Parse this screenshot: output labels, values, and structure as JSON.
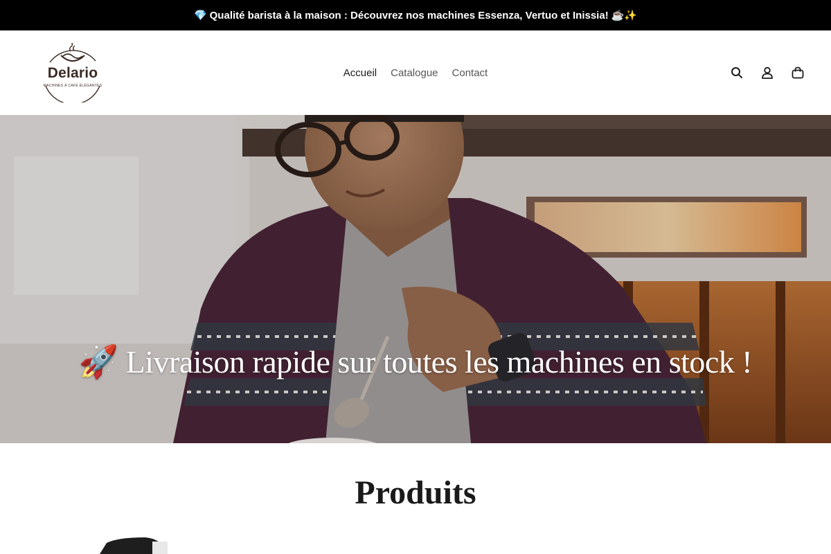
{
  "announcement": {
    "prefix_icon": "💎",
    "text": "Qualité barista à la maison : Découvrez nos machines Essenza, Vertuo et Inissia!",
    "suffix_icons": "☕✨"
  },
  "logo": {
    "name": "Delario",
    "tagline": "MACHINES À CAFÉ ÉLÉGANTES"
  },
  "nav": {
    "items": [
      {
        "label": "Accueil",
        "active": true
      },
      {
        "label": "Catalogue",
        "active": false
      },
      {
        "label": "Contact",
        "active": false
      }
    ]
  },
  "header_icons": [
    "search-icon",
    "account-icon",
    "cart-icon"
  ],
  "hero": {
    "text": "🚀 Livraison rapide sur toutes les machines en stock !"
  },
  "products": {
    "title": "Produits"
  },
  "colors": {
    "announcement_bg": "#000000",
    "logo_brown": "#3a2a24"
  }
}
